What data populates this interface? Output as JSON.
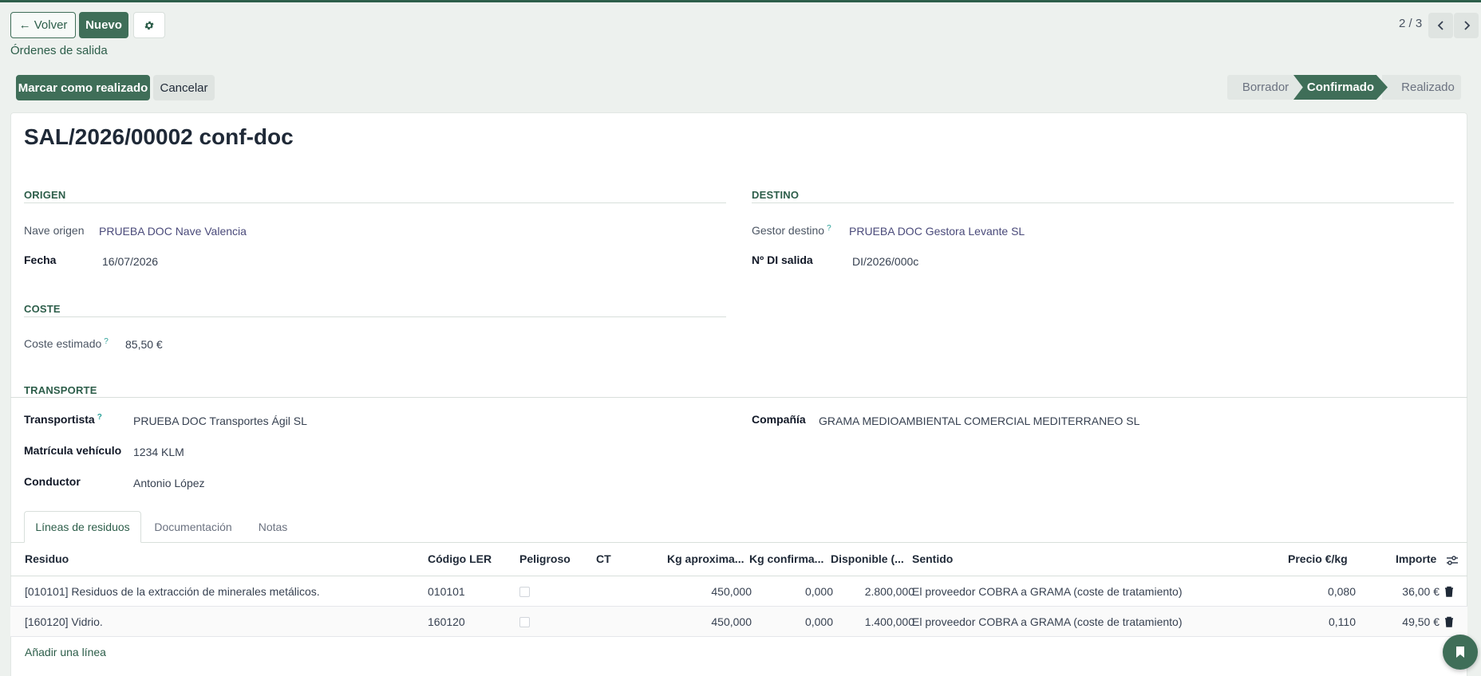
{
  "toolbar": {
    "back_label": "← Volver",
    "new_label": "Nuevo",
    "breadcrumb": "Órdenes de salida",
    "pager": "2 / 3"
  },
  "actions": {
    "done_label": "Marcar como realizado",
    "cancel_label": "Cancelar"
  },
  "status": {
    "steps": [
      "Borrador",
      "Confirmado",
      "Realizado"
    ],
    "active": "Confirmado"
  },
  "record": {
    "title": "SAL/2026/00002 conf-doc"
  },
  "origen": {
    "section": "ORIGEN",
    "nave_label": "Nave origen",
    "nave_value": "PRUEBA DOC Nave Valencia",
    "fecha_label": "Fecha",
    "fecha_value": "16/07/2026"
  },
  "destino": {
    "section": "DESTINO",
    "gestor_label": "Gestor destino",
    "gestor_value": "PRUEBA DOC Gestora Levante SL",
    "di_label": "Nº DI salida",
    "di_value": "DI/2026/000c"
  },
  "coste": {
    "section": "COSTE",
    "estimado_label": "Coste estimado",
    "estimado_value": "85,50 €"
  },
  "transporte": {
    "section": "TRANSPORTE",
    "transportista_label": "Transportista",
    "transportista_value": "PRUEBA DOC Transportes Ágil SL",
    "matricula_label": "Matrícula vehículo",
    "matricula_value": "1234 KLM",
    "conductor_label": "Conductor",
    "conductor_value": "Antonio López",
    "compania_label": "Compañía",
    "compania_value": "GRAMA MEDIOAMBIENTAL COMERCIAL MEDITERRANEO SL"
  },
  "tabs": [
    "Líneas de residuos",
    "Documentación",
    "Notas"
  ],
  "table": {
    "headers": [
      "Residuo",
      "Código LER",
      "Peligroso",
      "CT",
      "Kg aproxima...",
      "Kg confirma...",
      "Disponible (...",
      "Sentido",
      "Precio €/kg",
      "Importe"
    ],
    "rows": [
      [
        "[010101] Residuos de la extracción de minerales metálicos.",
        "010101",
        "",
        "",
        "450,000",
        "0,000",
        "2.800,000",
        "El proveedor COBRA a GRAMA (coste de tratamiento)",
        "0,080",
        "36,00 €"
      ],
      [
        "[160120] Vidrio.",
        "160120",
        "",
        "",
        "450,000",
        "0,000",
        "1.400,000",
        "El proveedor COBRA a GRAMA (coste de tratamiento)",
        "0,110",
        "49,50 €"
      ]
    ],
    "add_line": "Añadir una línea"
  },
  "icons": {
    "settings": "gear-icon",
    "prev": "chevron-left-icon",
    "next": "chevron-right-icon",
    "optional_columns": "sliders-icon",
    "delete": "trash-icon",
    "assistant": "bookmark-icon"
  },
  "colors": {
    "brand": "#3f6e58",
    "brand_dark": "#2d5e4a",
    "background": "#edf1ee"
  }
}
